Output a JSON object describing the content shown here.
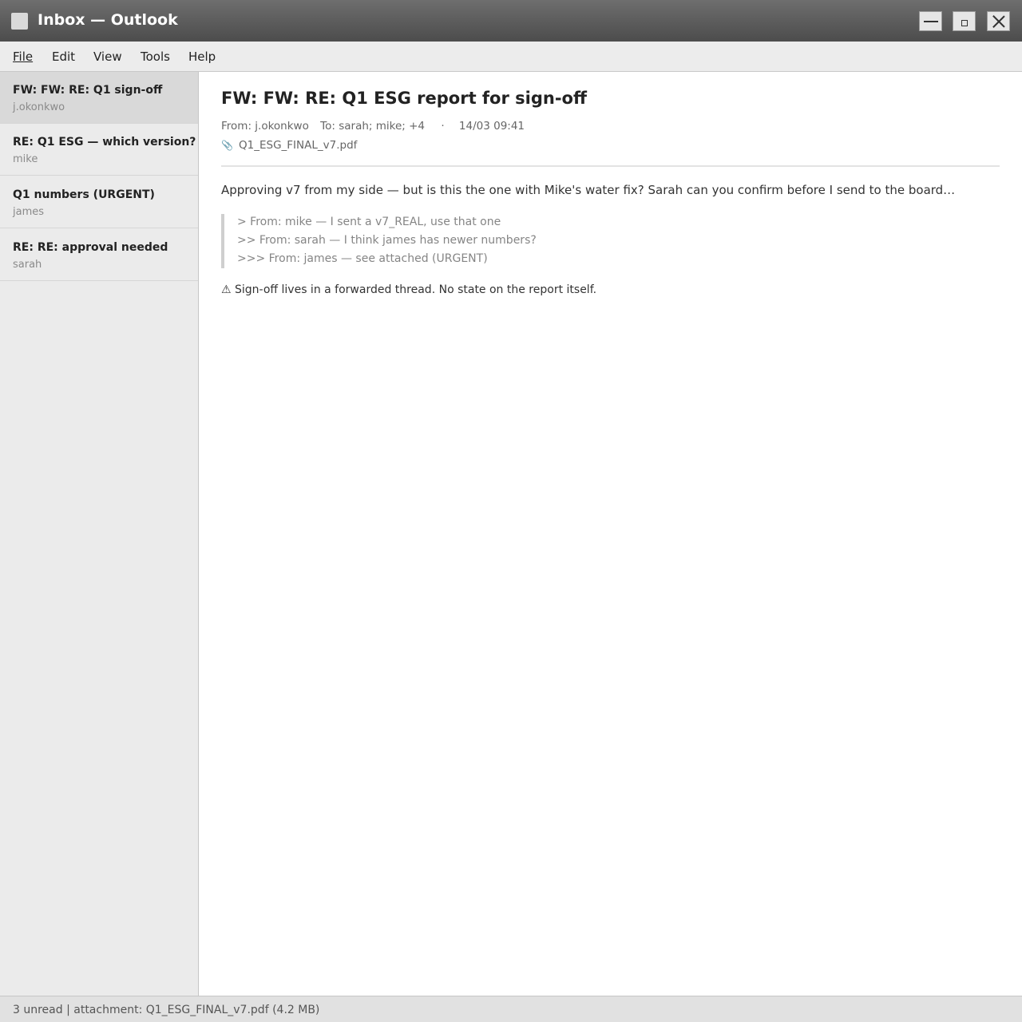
{
  "window": {
    "title": "Inbox — Outlook"
  },
  "menu": [
    "File",
    "Edit",
    "View",
    "Tools",
    "Help"
  ],
  "mail_list": [
    {
      "subject": "FW: FW: RE: Q1 sign-off",
      "sender": "j.okonkwo",
      "selected": true
    },
    {
      "subject": "RE: Q1 ESG — which version?",
      "sender": "mike",
      "selected": false
    },
    {
      "subject": "Q1 numbers (URGENT)",
      "sender": "james",
      "selected": false
    },
    {
      "subject": "RE: RE: approval needed",
      "sender": "sarah",
      "selected": false
    }
  ],
  "message": {
    "subject": "FW: FW: RE: Q1 ESG report for sign-off",
    "from": "From: j.okonkwo",
    "to": "To: sarah; mike; +4",
    "separator": "·",
    "datetime": "14/03 09:41",
    "attachment": "Q1_ESG_FINAL_v7.pdf",
    "body": "Approving v7 from my side — but is this the one with Mike's water fix? Sarah can you confirm before I send to the board…",
    "quoted": [
      "> From: mike — I sent a v7_REAL, use that one",
      ">> From: sarah — I think james has newer numbers?",
      ">>> From: james — see attached (URGENT)"
    ],
    "warning": "⚠ Sign-off lives in a forwarded thread. No state on the report itself."
  },
  "status": {
    "text": "3 unread | attachment: Q1_ESG_FINAL_v7.pdf (4.2 MB)"
  },
  "icons": {
    "app": "app-icon",
    "minimize": "minimize-icon",
    "maximize": "maximize-icon",
    "close": "close-icon",
    "attachment": "paperclip-icon"
  },
  "colors": {
    "titlebar": "#555555",
    "sidebar": "#ebebeb",
    "selected_item": "#d9d9d9",
    "statusbar": "#e1e1e1"
  }
}
